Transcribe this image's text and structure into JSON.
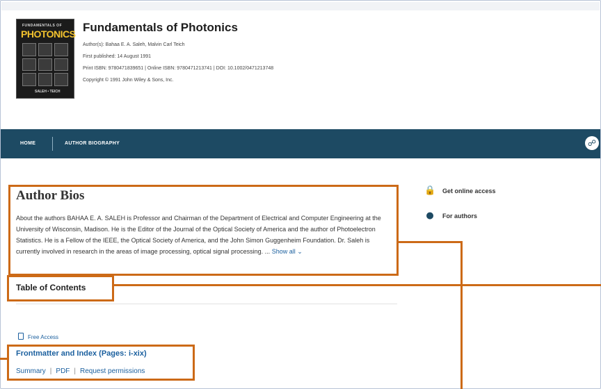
{
  "book": {
    "cover": {
      "top_text": "FUNDAMENTALS OF",
      "title": "PHOTONICS",
      "bottom_text": "SALEH • TEICH"
    },
    "title": "Fundamentals of Photonics",
    "authors": "Author(s): Bahaa E. A. Saleh, Malvin Carl Teich",
    "published": "First published: 14 August 1991",
    "isbn": "Print ISBN: 9780471839651 | Online ISBN: 9780471213741 | DOI: 10.1002/0471213748",
    "copyright": "Copyright © 1991 John Wiley & Sons, Inc."
  },
  "nav": {
    "home": "HOME",
    "bio": "AUTHOR BIOGRAPHY",
    "share_icon": "share-icon"
  },
  "main": {
    "author_bios_title": "Author Bios",
    "bio_text": "About the authors BAHAA E. A. SALEH is Professor and Chairman of the Department of Electrical and Computer Engineering at the University of Wisconsin, Madison. He is the Editor of the Journal of the Optical Society of America and the author of Photoelectron Statistics. He is a Fellow of the IEEE, the Optical Society of America, and the John Simon Guggenheim Foundation. Dr. Saleh is currently involved in research in the areas of image processing, optical signal processing. ...",
    "show_all": "Show all",
    "toc_title": "Table of Contents",
    "free_access": "Free Access",
    "frontmatter": "Frontmatter and Index (Pages: i-xix)",
    "actions": [
      "Summary",
      "PDF",
      "Request permissions"
    ]
  },
  "sidebar": {
    "online_access": "Get online access",
    "for_authors": "For authors"
  },
  "colors": {
    "nav": "#1d4a63",
    "link": "#1a5f9e",
    "annotation": "#cc6a17"
  }
}
